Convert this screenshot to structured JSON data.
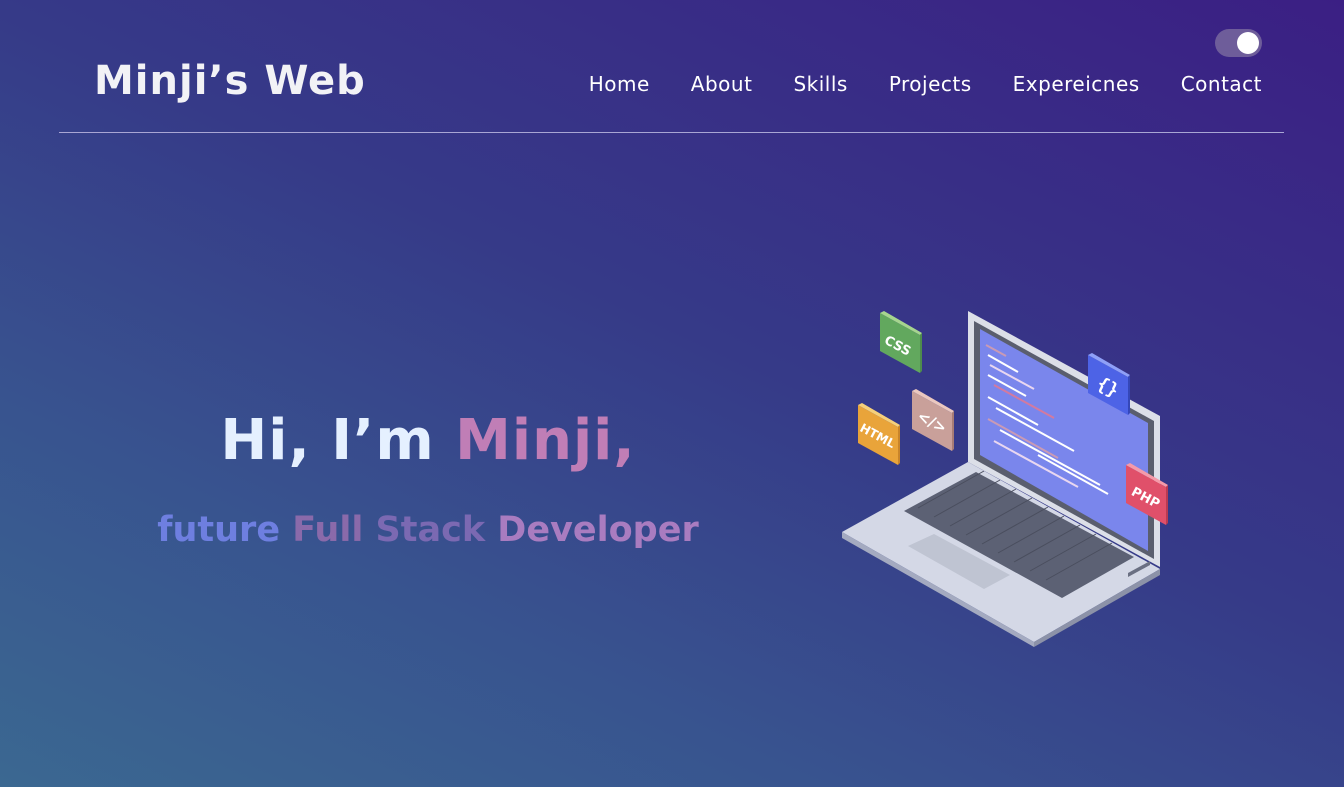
{
  "header": {
    "logo": "Minji’s Web",
    "theme_toggle": {
      "state": "on"
    },
    "nav": [
      {
        "label": "Home"
      },
      {
        "label": "About"
      },
      {
        "label": "Skills"
      },
      {
        "label": "Projects"
      },
      {
        "label": "Expereicnes"
      },
      {
        "label": "Contact"
      }
    ]
  },
  "hero": {
    "greeting": "Hi, I’m ",
    "name": "Minji,",
    "subtitle": {
      "w1": "future ",
      "w2": "Full ",
      "w3": "Stack ",
      "w4": "Developer"
    }
  },
  "illustration": {
    "badges": {
      "css": "CSS",
      "html": "HTML",
      "code": "</>",
      "braces": "{}",
      "php": "PHP"
    }
  },
  "colors": {
    "accent_name": "#c07eb6",
    "greeting": "#e5f0ff",
    "toggle_track": "#6e5d9a"
  }
}
